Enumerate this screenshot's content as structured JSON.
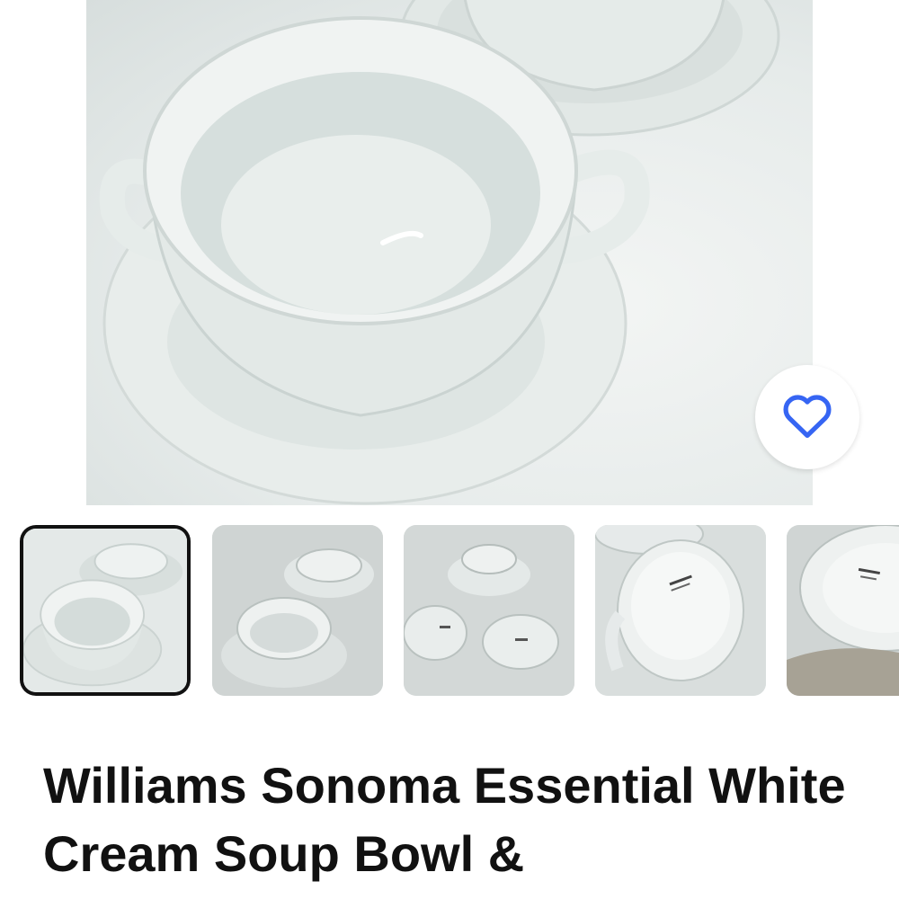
{
  "product": {
    "title": "Williams Sonoma Essential White Cream Soup Bowl &"
  },
  "gallery": {
    "thumbnail_count": 5,
    "selected_index": 0
  },
  "icons": {
    "favorite": "heart-outline-icon"
  },
  "colors": {
    "accent": "#3665f3",
    "title_text": "#111111",
    "selected_border": "#111111"
  }
}
